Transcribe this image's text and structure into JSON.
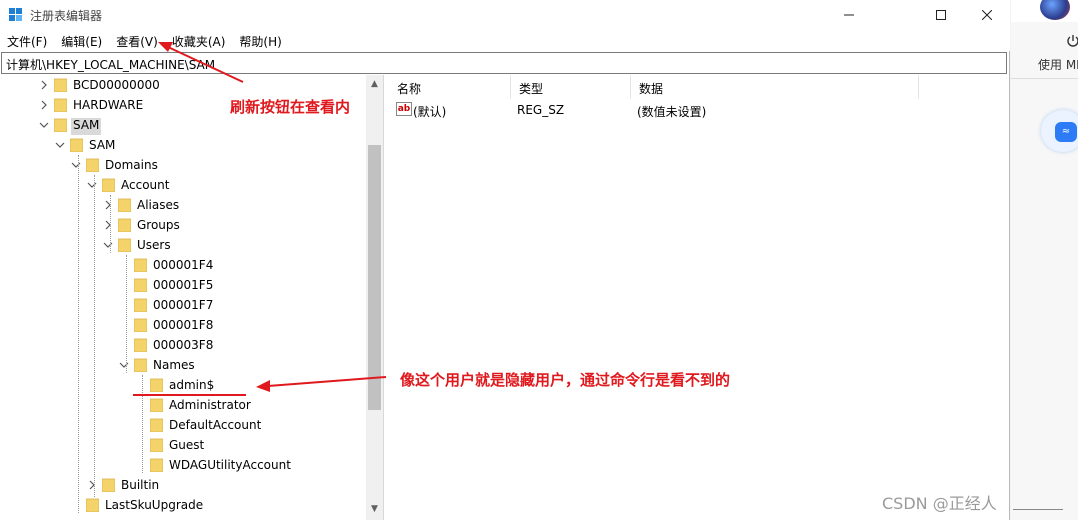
{
  "window": {
    "title": "注册表编辑器",
    "minimize": "minimize",
    "maximize": "maximize",
    "close": "close"
  },
  "menu": [
    "文件(F)",
    "编辑(E)",
    "查看(V)",
    "收藏夹(A)",
    "帮助(H)"
  ],
  "address": "计算机\\HKEY_LOCAL_MACHINE\\SAM",
  "tree": [
    {
      "label": "BCD00000000",
      "chevron": "right"
    },
    {
      "label": "HARDWARE",
      "chevron": "right"
    },
    {
      "label": "SAM",
      "chevron": "down",
      "selected": true
    },
    {
      "label": "SAM",
      "chevron": "down"
    },
    {
      "label": "Domains",
      "chevron": "down"
    },
    {
      "label": "Account",
      "chevron": "down"
    },
    {
      "label": "Aliases",
      "chevron": "right"
    },
    {
      "label": "Groups",
      "chevron": "right"
    },
    {
      "label": "Users",
      "chevron": "down"
    },
    {
      "label": "000001F4",
      "chevron": ""
    },
    {
      "label": "000001F5",
      "chevron": ""
    },
    {
      "label": "000001F7",
      "chevron": ""
    },
    {
      "label": "000001F8",
      "chevron": ""
    },
    {
      "label": "000003F8",
      "chevron": ""
    },
    {
      "label": "Names",
      "chevron": "down"
    },
    {
      "label": "admin$",
      "chevron": ""
    },
    {
      "label": "Administrator",
      "chevron": ""
    },
    {
      "label": "DefaultAccount",
      "chevron": ""
    },
    {
      "label": "Guest",
      "chevron": ""
    },
    {
      "label": "WDAGUtilityAccount",
      "chevron": ""
    },
    {
      "label": "Builtin",
      "chevron": "right"
    },
    {
      "label": "LastSkuUpgrade",
      "chevron": ""
    }
  ],
  "list": {
    "columns": [
      "名称",
      "类型",
      "数据"
    ],
    "rows": [
      {
        "name": "(默认)",
        "type": "REG_SZ",
        "data": "(数值未设置)",
        "icon": "ab-icon"
      }
    ]
  },
  "annotations": {
    "refresh": "刷新按钮在查看内",
    "hidden_user": "像这个用户就是隐藏用户，通过命令行是看不到的"
  },
  "side_app": {
    "label": "使用 MI",
    "icon": "power-icon"
  },
  "watermark": "CSDN @正经人",
  "colors": {
    "annotation": "#e0191e",
    "folder": "#f5d36b",
    "selection": "#d9d9d9"
  }
}
